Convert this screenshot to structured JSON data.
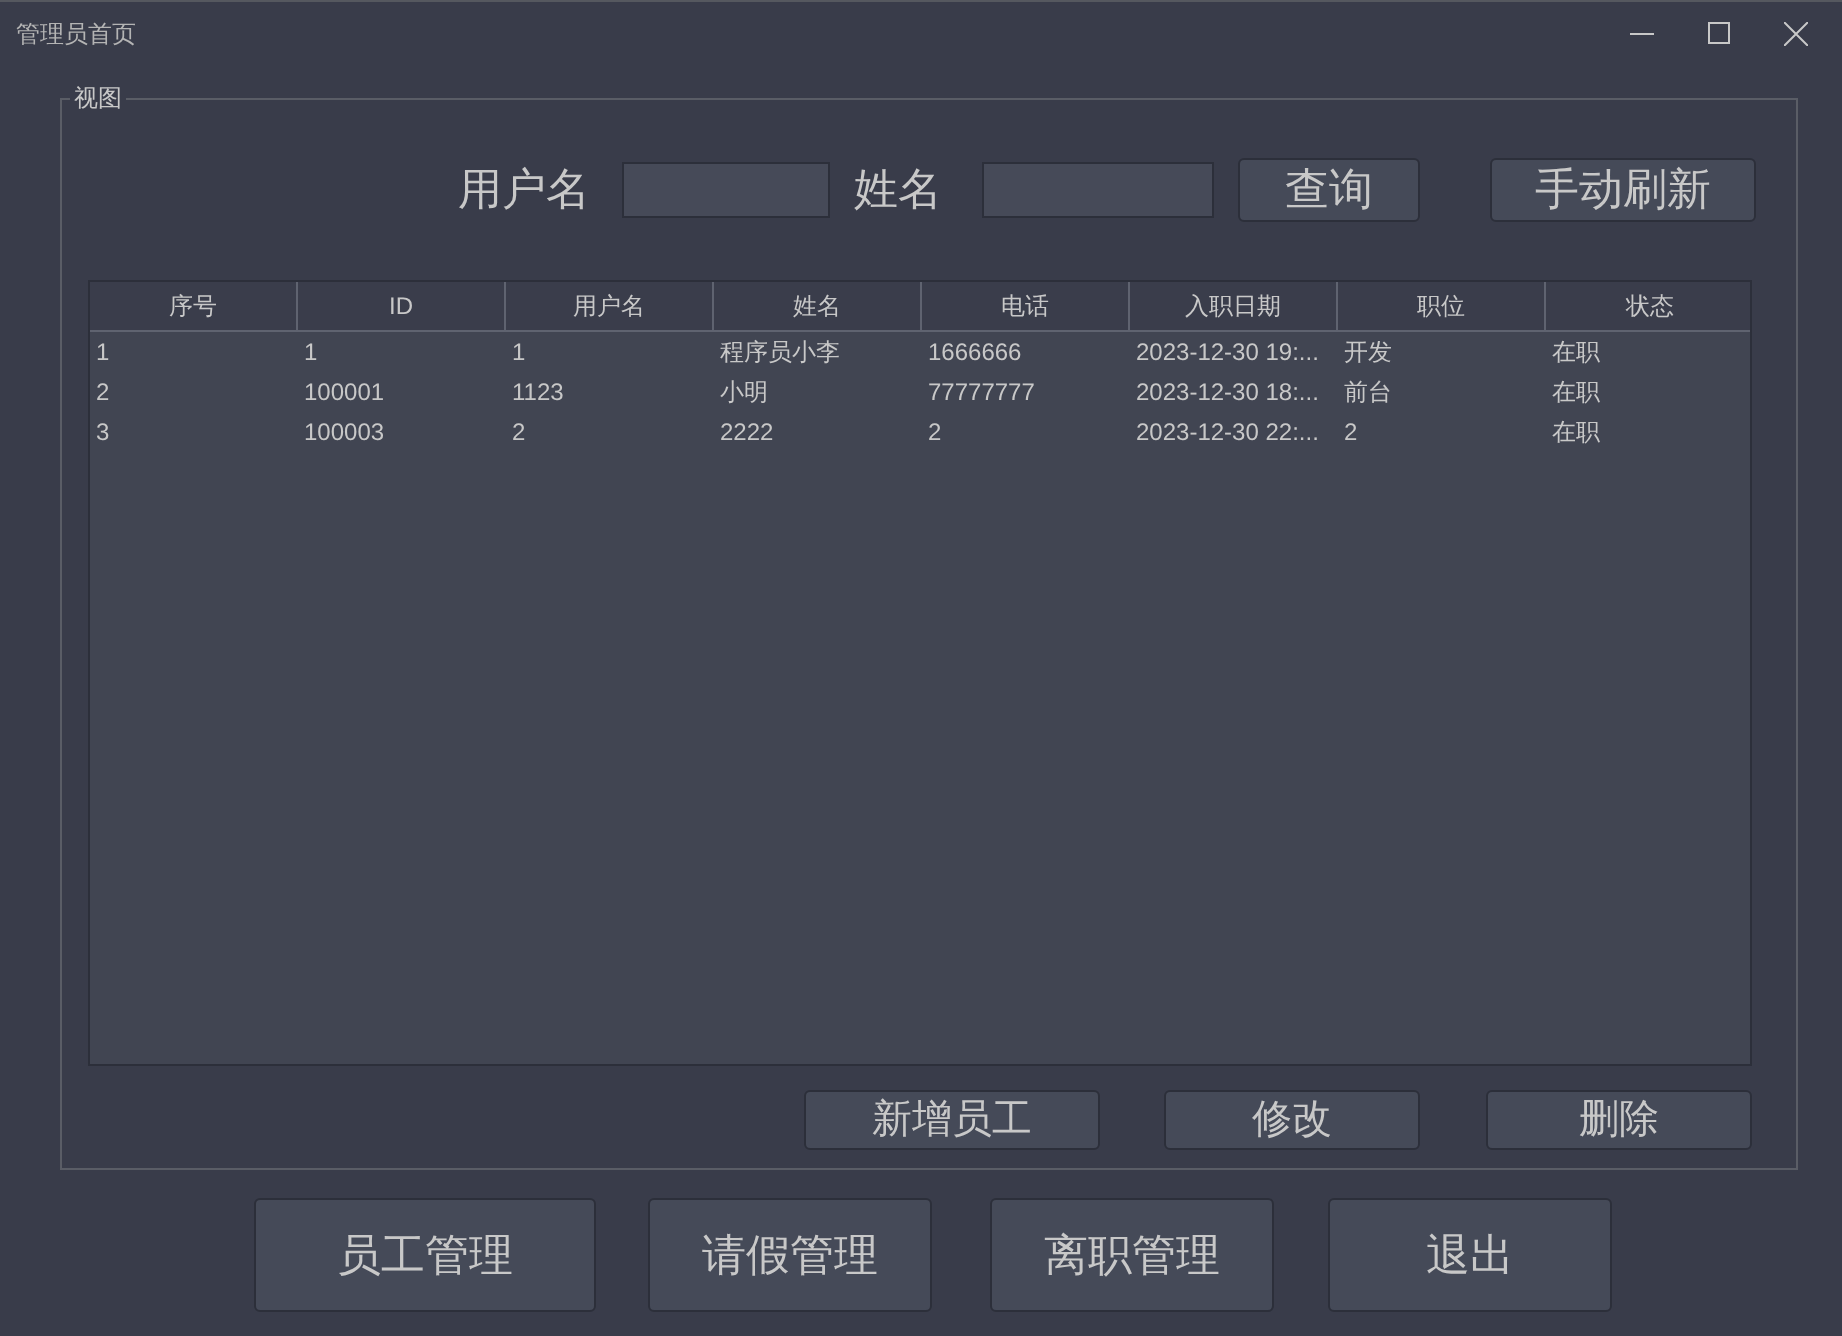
{
  "window": {
    "title": "管理员首页"
  },
  "group": {
    "title": "视图"
  },
  "search": {
    "fields": [
      {
        "label": "用户名"
      },
      {
        "label": "姓名"
      }
    ],
    "buttons": [
      "查询",
      "手动刷新"
    ]
  },
  "table": {
    "columns": [
      "序号",
      "ID",
      "用户名",
      "姓名",
      "电话",
      "入职日期",
      "职位",
      "状态"
    ],
    "rows": [
      [
        "1",
        "1",
        "1",
        "程序员小李",
        "1666666",
        "2023-12-30 19:...",
        "开发",
        "在职"
      ],
      [
        "2",
        "100001",
        "1123",
        "小明",
        "77777777",
        "2023-12-30 18:...",
        "前台",
        "在职"
      ],
      [
        "3",
        "100003",
        "2",
        "2222",
        "2",
        "2023-12-30 22:...",
        "2",
        "在职"
      ]
    ]
  },
  "actions": [
    "新增员工",
    "修改",
    "删除"
  ],
  "nav": [
    "员工管理",
    "请假管理",
    "离职管理",
    "退出"
  ]
}
